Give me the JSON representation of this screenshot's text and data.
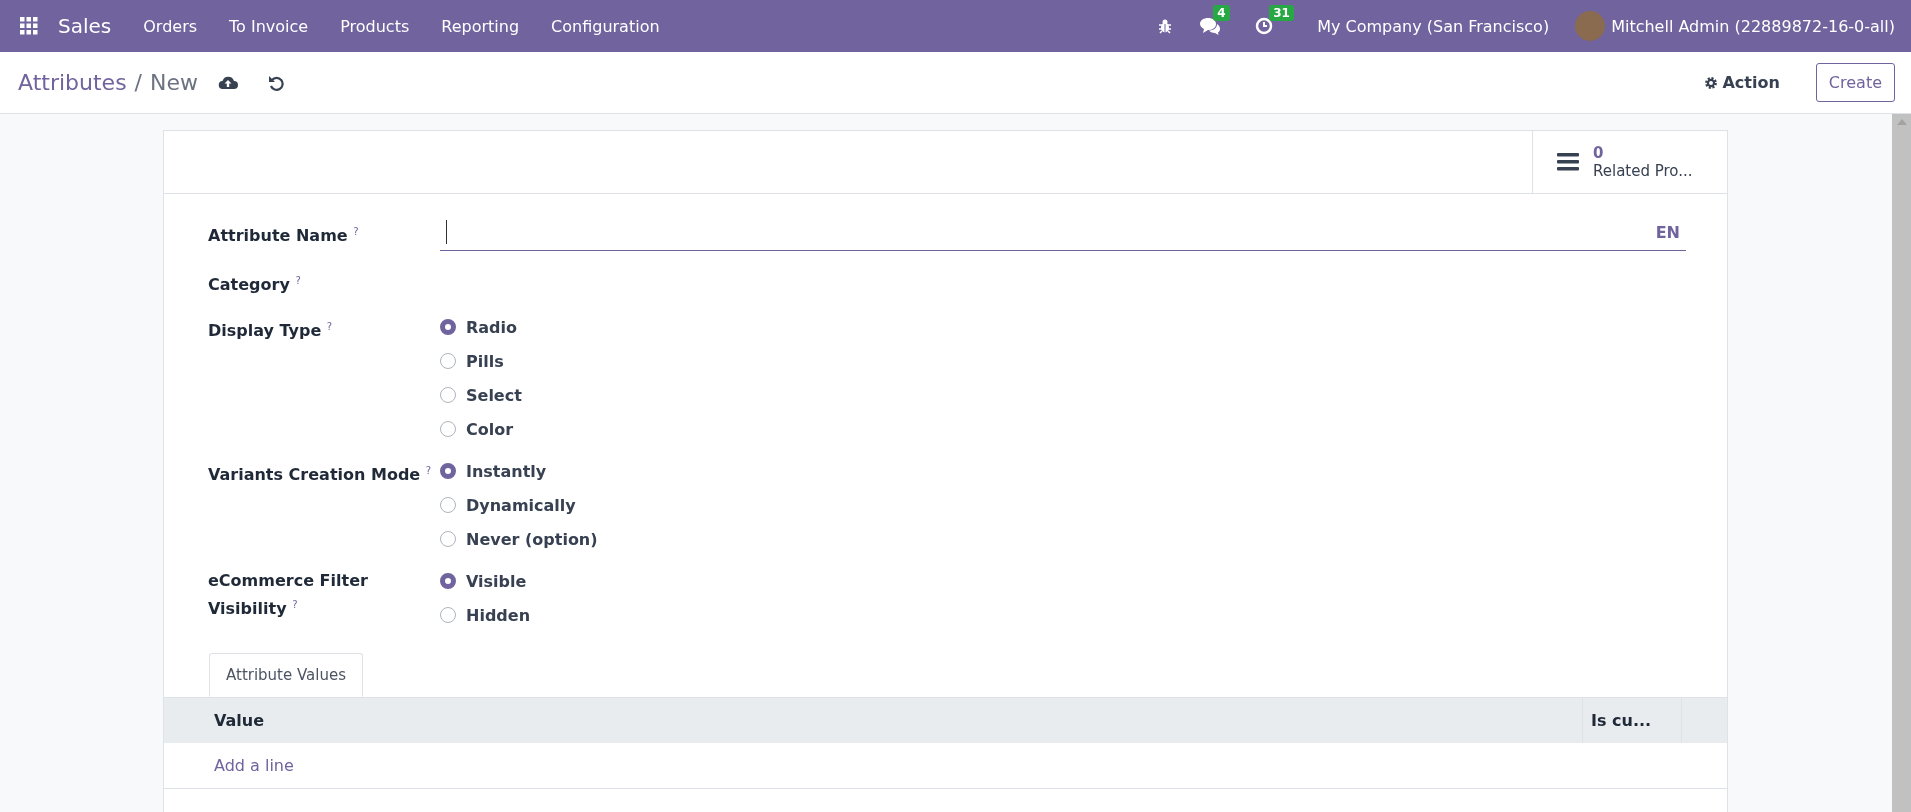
{
  "navbar": {
    "app": "Sales",
    "menu": [
      "Orders",
      "To Invoice",
      "Products",
      "Reporting",
      "Configuration"
    ],
    "messages_count": "4",
    "activities_count": "31",
    "company": "My Company (San Francisco)",
    "user": "Mitchell Admin (22889872-16-0-all)"
  },
  "breadcrumb": {
    "parent": "Attributes",
    "separator": "/",
    "current": "New"
  },
  "actions": {
    "action": "Action",
    "create": "Create"
  },
  "smart_button": {
    "count": "0",
    "label": "Related Pro..."
  },
  "form": {
    "name_label": "Attribute Name $^{?}$",
    "language": "EN",
    "category_label": "Category $^{?}$",
    "radio_groups": [
      {
        "label": "Display Type $^{?}$",
        "options": [
          {
            "label": "Radio",
            "selected": true
          },
          {
            "label": "Pills",
            "selected": false
          },
          {
            "label": "Select",
            "selected": false
          },
          {
            "label": "Color",
            "selected": false
          }
        ]
      },
      {
        "label": "Variants Creation Mode $^{?}$",
        "options": [
          {
            "label": "Instantly",
            "selected": true
          },
          {
            "label": "Dynamically",
            "selected": false
          },
          {
            "label": "Never (option)",
            "selected": false
          }
        ]
      },
      {
        "label": "eCommerce Filter Visibility $^{?}$",
        "options": [
          {
            "label": "Visible",
            "selected": true
          },
          {
            "label": "Hidden",
            "selected": false
          }
        ]
      }
    ]
  },
  "tabs": [
    {
      "label": "Attribute Values",
      "selected": true
    }
  ],
  "table": {
    "columns": [
      "Value",
      "Is cu..."
    ],
    "add_line": "Add a line"
  }
}
